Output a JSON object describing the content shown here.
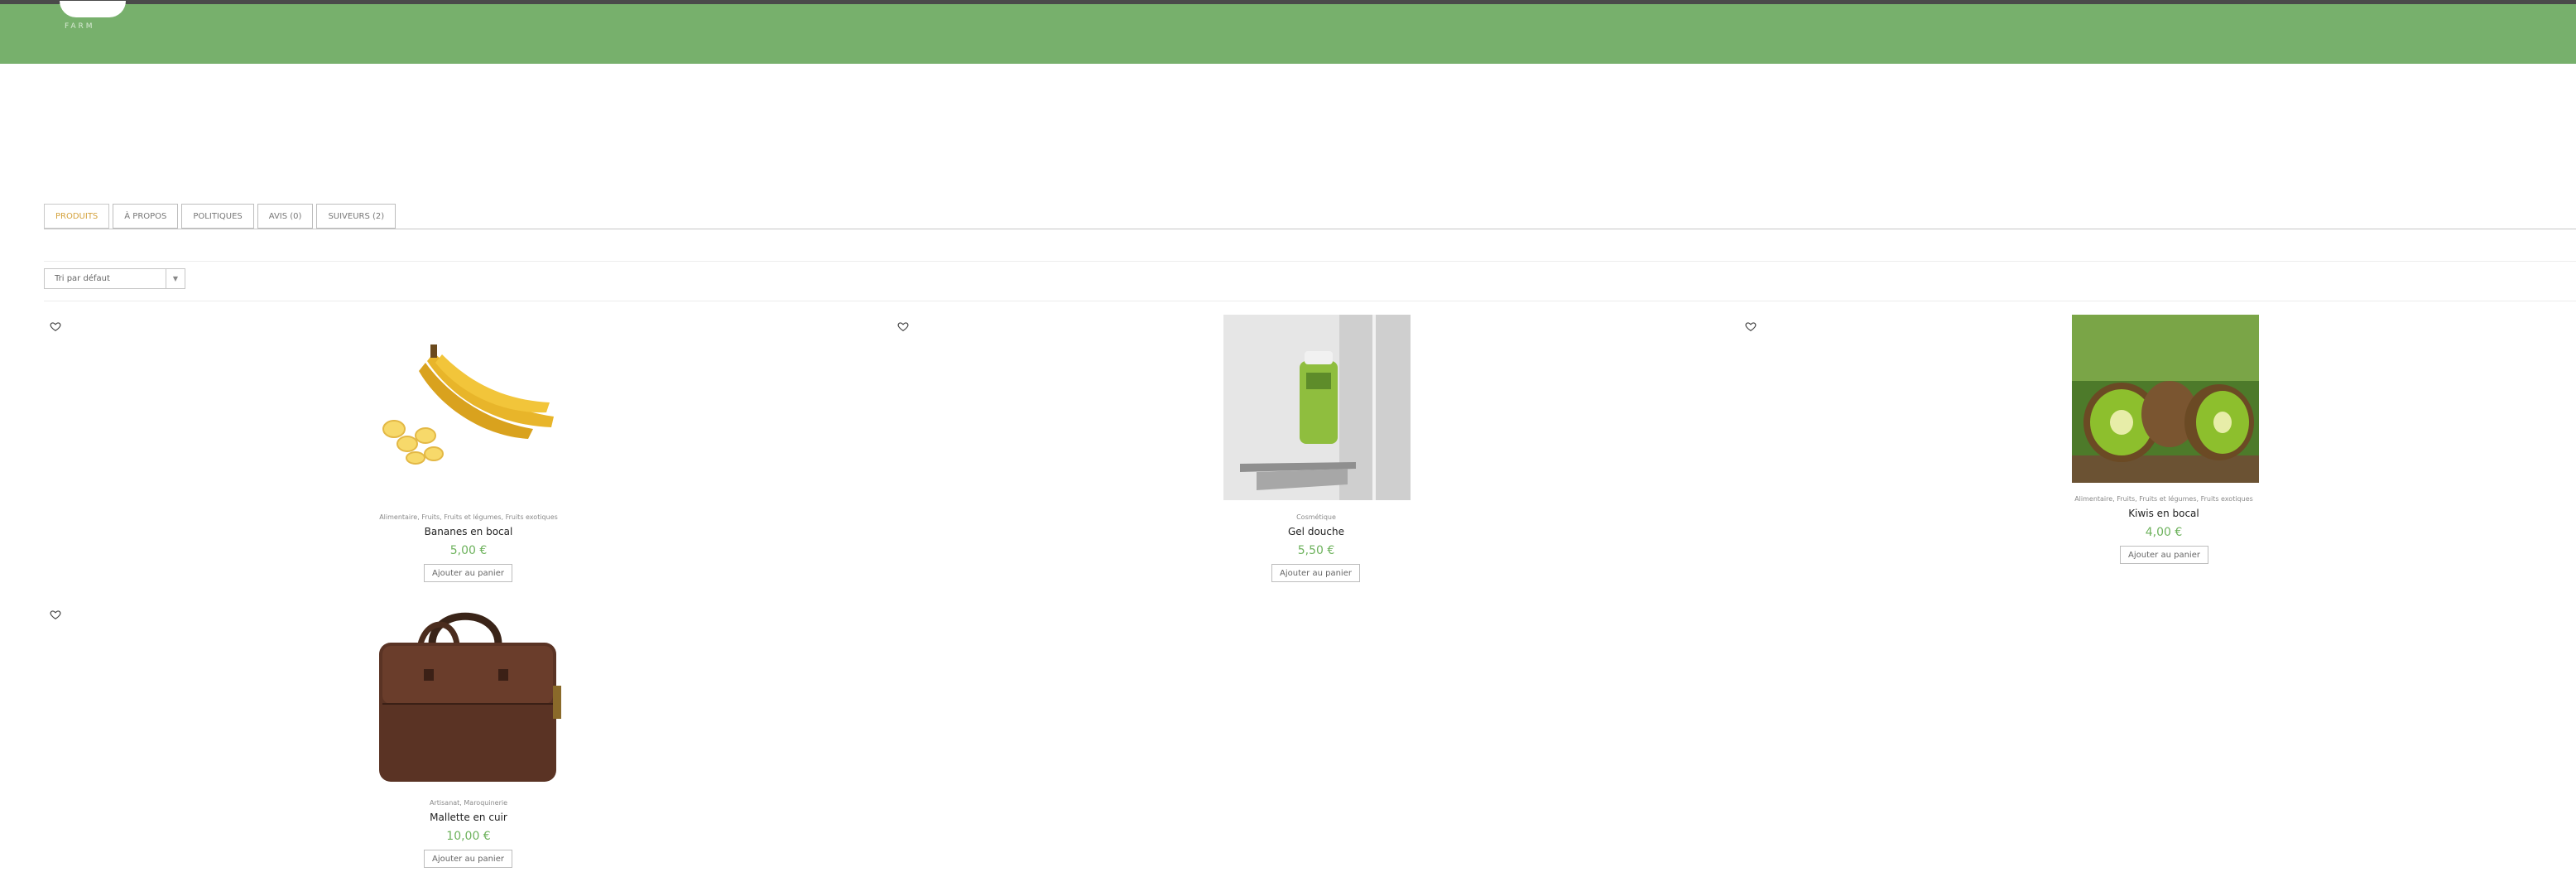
{
  "header": {
    "brand_text": "FARM",
    "brand_color": "#77b06c"
  },
  "tabs": [
    {
      "label": "PRODUITS",
      "active": true
    },
    {
      "label": "À PROPOS"
    },
    {
      "label": "POLITIQUES"
    },
    {
      "label": "AVIS (0)"
    },
    {
      "label": "SUIVEURS (2)"
    }
  ],
  "sort": {
    "selected": "Tri par défaut",
    "arrow_icon": "chevron-down-icon"
  },
  "products": [
    {
      "categories": "Alimentaire, Fruits, Fruits et légumes, Fruits exotiques",
      "name": "Bananes en bocal",
      "price": "5,00 €",
      "button": "Ajouter au panier"
    },
    {
      "categories": "Cosmétique",
      "name": "Gel douche",
      "price": "5,50 €",
      "button": "Ajouter au panier"
    },
    {
      "categories": "Alimentaire, Fruits, Fruits et légumes, Fruits exotiques",
      "name": "Kiwis en bocal",
      "price": "4,00 €",
      "button": "Ajouter au panier"
    },
    {
      "categories": "Artisanat, Maroquinerie",
      "name": "Mallette en cuir",
      "price": "10,00 €",
      "button": "Ajouter au panier"
    }
  ],
  "colors": {
    "accent_tab": "#d4a23c",
    "price": "#6db25c"
  }
}
